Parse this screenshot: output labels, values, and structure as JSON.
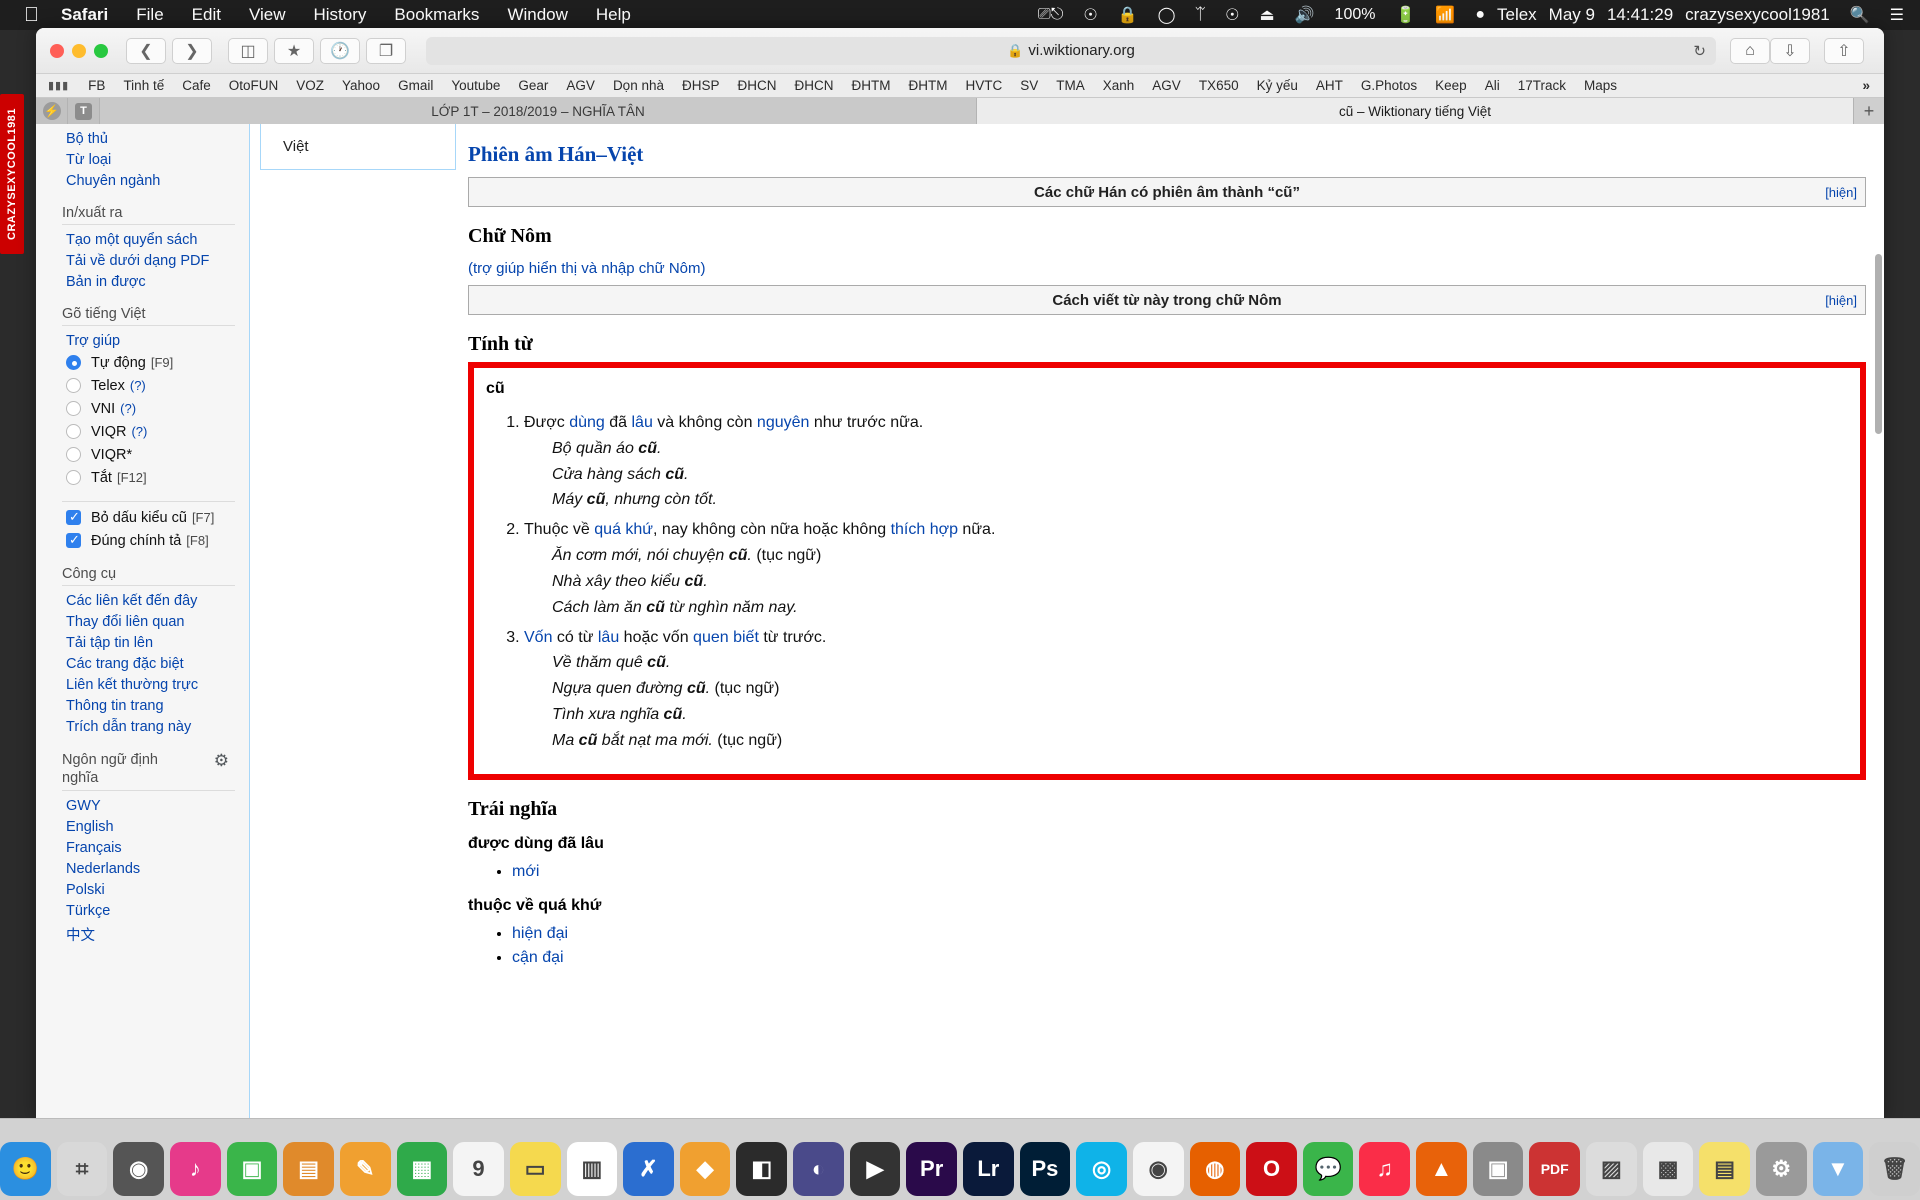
{
  "menubar": {
    "apple": "",
    "items": [
      "Safari",
      "File",
      "Edit",
      "View",
      "History",
      "Bookmarks",
      "Window",
      "Help"
    ],
    "status": {
      "screenshot_icon": "screenshot-icon",
      "creative_cloud_icon": "creative-cloud-icon",
      "lock_icon": "lock-icon",
      "chat_icon": "chat-bubble-icon",
      "bluetooth_icon": "bluetooth-icon",
      "accessibility_icon": "accessibility-icon",
      "eject_icon": "eject-icon",
      "volume_icon": "volume-icon",
      "battery_percent": "100%",
      "battery_icon": "battery-charging-icon",
      "wifi_icon": "wifi-icon",
      "input_method_icon": "keyboard-input-icon",
      "input_method": "Telex",
      "date": "May 9",
      "time": "14:41:29",
      "user": "crazysexycool1981",
      "search_icon": "search-icon",
      "control_center_icon": "control-center-icon"
    }
  },
  "toolbar": {
    "back_icon": "chevron-left-icon",
    "forward_icon": "chevron-right-icon",
    "sidebar_icon": "sidebar-icon",
    "bookmarks_icon": "star-bookmarks-icon",
    "history_icon": "clock-history-icon",
    "tabs_icon": "tab-overview-icon",
    "url": "vi.wiktionary.org",
    "lock_icon": "lock-icon",
    "reload_icon": "reload-icon",
    "home_icon": "home-icon",
    "download_icon": "download-icon",
    "share_icon": "share-icon"
  },
  "bookmarks": {
    "grid_icon": "apps-grid-icon",
    "items": [
      "FB",
      "Tinh tế",
      "Cafe",
      "OtoFUN",
      "VOZ",
      "Yahoo",
      "Gmail",
      "Youtube",
      "Gear",
      "AGV",
      "Dọn nhà",
      "ĐHSP",
      "ĐHCN",
      "ĐHCN",
      "ĐHTM",
      "ĐHTM",
      "HVTC",
      "SV",
      "TMA",
      "Xanh",
      "AGV",
      "TX650",
      "Kỷ yếu",
      "AHT",
      "G.Photos",
      "Keep",
      "Ali",
      "17Track",
      "Maps"
    ],
    "overflow": "»"
  },
  "tabs": {
    "messenger_icon": "messenger-icon",
    "telex_icon": "telex-icon",
    "items": [
      {
        "label": "LỚP 1T – 2018/2019 – NGHĨA TÂN",
        "active": false
      },
      {
        "label": "cũ – Wiktionary tiếng Việt",
        "active": true
      }
    ],
    "new_tab": "+"
  },
  "left_strip": {
    "label": "CRAZYSEXYCOOL1981"
  },
  "sidebar": {
    "top_links": [
      "Bộ thủ",
      "Từ loại",
      "Chuyên ngành"
    ],
    "sections": [
      {
        "title": "In/xuất ra",
        "links": [
          "Tạo một quyển sách",
          "Tải về dưới dạng PDF",
          "Bản in được"
        ]
      },
      {
        "title": "Gõ tiếng Việt",
        "links": [
          "Trợ giúp"
        ]
      }
    ],
    "input_modes": [
      {
        "label": "Tự động",
        "key": "[F9]",
        "hint": "",
        "selected": true
      },
      {
        "label": "Telex",
        "key": "",
        "hint": "(?)",
        "selected": false
      },
      {
        "label": "VNI",
        "key": "",
        "hint": "(?)",
        "selected": false
      },
      {
        "label": "VIQR",
        "key": "",
        "hint": "(?)",
        "selected": false
      },
      {
        "label": "VIQR*",
        "key": "",
        "hint": "",
        "selected": false
      },
      {
        "label": "Tắt",
        "key": "[F12]",
        "hint": "",
        "selected": false
      }
    ],
    "checkboxes": [
      {
        "label": "Bỏ dấu kiểu cũ",
        "key": "[F7]",
        "checked": true
      },
      {
        "label": "Đúng chính tả",
        "key": "[F8]",
        "checked": true
      }
    ],
    "tools_title": "Công cụ",
    "tools": [
      "Các liên kết đến đây",
      "Thay đổi liên quan",
      "Tải tập tin lên",
      "Các trang đặc biệt",
      "Liên kết thường trực",
      "Thông tin trang",
      "Trích dẫn trang này"
    ],
    "langs_title": "Ngôn ngữ định nghĩa",
    "langs_gear_icon": "gear-icon",
    "langs": [
      "GWY",
      "English",
      "Français",
      "Nederlands",
      "Polski",
      "Türkçe",
      "中文"
    ]
  },
  "namespace_tab": "Việt",
  "article": {
    "h_phien_am": "Phiên âm Hán–Việt",
    "navbox_han": {
      "title": "Các chữ Hán có phiên âm thành “cũ”",
      "toggle": "[hiện]"
    },
    "h_chu_nom": "Chữ Nôm",
    "nom_help": "(trợ giúp hiển thị và nhập chữ Nôm)",
    "navbox_nom": {
      "title": "Cách viết từ này trong chữ Nôm",
      "toggle": "[hiện]"
    },
    "h_tinh_tu": "Tính từ",
    "lemma": "cũ",
    "definitions": [
      {
        "num": "1.",
        "parts": [
          {
            "t": "Được ",
            "link": false
          },
          {
            "t": "dùng",
            "link": true
          },
          {
            "t": " đã ",
            "link": false
          },
          {
            "t": "lâu",
            "link": true
          },
          {
            "t": " và không còn ",
            "link": false
          },
          {
            "t": "nguyên",
            "link": true
          },
          {
            "t": " như trước nữa.",
            "link": false
          }
        ],
        "examples": [
          {
            "italic": "Bộ quần áo ",
            "bold": "cũ",
            "tail": ".",
            "note": ""
          },
          {
            "italic": "Cửa hàng sách ",
            "bold": "cũ",
            "tail": ".",
            "note": ""
          },
          {
            "italic": "Máy ",
            "bold": "cũ",
            "tail": ", nhưng còn tốt.",
            "note": ""
          }
        ]
      },
      {
        "num": "2.",
        "parts": [
          {
            "t": "Thuộc về ",
            "link": false
          },
          {
            "t": "quá khứ",
            "link": true
          },
          {
            "t": ", nay không còn nữa hoặc không ",
            "link": false
          },
          {
            "t": "thích hợp",
            "link": true
          },
          {
            "t": " nữa.",
            "link": false
          }
        ],
        "examples": [
          {
            "italic": "Ăn cơm mới, nói chuyện ",
            "bold": "cũ",
            "tail": ".",
            "note": " (tục ngữ)"
          },
          {
            "italic": "Nhà xây theo kiểu ",
            "bold": "cũ",
            "tail": ".",
            "note": ""
          },
          {
            "italic": "Cách làm ăn ",
            "bold": "cũ",
            "tail": " từ nghìn năm nay.",
            "note": ""
          }
        ]
      },
      {
        "num": "3.",
        "parts": [
          {
            "t": "Vốn",
            "link": true
          },
          {
            "t": " có từ ",
            "link": false
          },
          {
            "t": "lâu",
            "link": true
          },
          {
            "t": " hoặc vốn ",
            "link": false
          },
          {
            "t": "quen biết",
            "link": true
          },
          {
            "t": " từ trước.",
            "link": false
          }
        ],
        "examples": [
          {
            "italic": "Về thăm quê ",
            "bold": "cũ",
            "tail": ".",
            "note": ""
          },
          {
            "italic": "Ngựa quen đường ",
            "bold": "cũ",
            "tail": ".",
            "note": " (tục ngữ)"
          },
          {
            "italic": "Tình xưa nghĩa ",
            "bold": "cũ",
            "tail": ".",
            "note": ""
          },
          {
            "italic": "Ma ",
            "bold": "cũ",
            "tail": " bắt nạt ma mới.",
            "note": " (tục ngữ)"
          }
        ]
      }
    ],
    "h_trai_nghia": "Trái nghĩa",
    "antonym_groups": [
      {
        "title": "được dùng đã lâu",
        "items": [
          "mới"
        ]
      },
      {
        "title": "thuộc về quá khứ",
        "items": [
          "hiện đại",
          "cận đại"
        ]
      }
    ]
  },
  "dock": {
    "items": [
      {
        "name": "finder",
        "glyph": "🙂",
        "color": "#2b8fe0"
      },
      {
        "name": "launchpad",
        "glyph": "⌗",
        "color": "#d8d8d8"
      },
      {
        "name": "photo-booth",
        "glyph": "◉",
        "color": "#555"
      },
      {
        "name": "itunes",
        "glyph": "♪",
        "color": "#e63a8a"
      },
      {
        "name": "facetime",
        "glyph": "▣",
        "color": "#3ab54a"
      },
      {
        "name": "books",
        "glyph": "▤",
        "color": "#e08a2b"
      },
      {
        "name": "pages",
        "glyph": "✎",
        "color": "#f0a030"
      },
      {
        "name": "numbers",
        "glyph": "▦",
        "color": "#2faa4a"
      },
      {
        "name": "keynote",
        "glyph": "9",
        "color": "#f4f4f4"
      },
      {
        "name": "notes",
        "glyph": "▭",
        "color": "#f5d94e"
      },
      {
        "name": "calendar",
        "glyph": "▥",
        "color": "#ffffff"
      },
      {
        "name": "xcode",
        "glyph": "✗",
        "color": "#2b6ed0"
      },
      {
        "name": "sketch",
        "glyph": "◆",
        "color": "#f0a030"
      },
      {
        "name": "final-cut",
        "glyph": "◧",
        "color": "#2b2b2b"
      },
      {
        "name": "compressor",
        "glyph": "◐",
        "color": "#4a4a8a"
      },
      {
        "name": "logic",
        "glyph": "▶",
        "color": "#333"
      },
      {
        "name": "premiere",
        "glyph": "Pr",
        "color": "#2a0a4a"
      },
      {
        "name": "lightroom",
        "glyph": "Lr",
        "color": "#0a1a3a"
      },
      {
        "name": "photoshop",
        "glyph": "Ps",
        "color": "#001e36"
      },
      {
        "name": "safari",
        "glyph": "◎",
        "color": "#0fb3e8"
      },
      {
        "name": "chrome",
        "glyph": "◉",
        "color": "#f4f4f4"
      },
      {
        "name": "firefox",
        "glyph": "◍",
        "color": "#e66000"
      },
      {
        "name": "opera",
        "glyph": "O",
        "color": "#cc0f16"
      },
      {
        "name": "messages",
        "glyph": "💬",
        "color": "#3ab54a"
      },
      {
        "name": "music",
        "glyph": "♫",
        "color": "#fa2d48"
      },
      {
        "name": "vlc",
        "glyph": "▲",
        "color": "#e8620a"
      },
      {
        "name": "unarchiver",
        "glyph": "▣",
        "color": "#8a8a8a"
      },
      {
        "name": "pdf-expert",
        "glyph": "PDF",
        "color": "#cc3333"
      },
      {
        "name": "preview",
        "glyph": "▨",
        "color": "#dcdcdc"
      },
      {
        "name": "shutter-counter",
        "glyph": "▩",
        "color": "#e8e8e8"
      },
      {
        "name": "stickies",
        "glyph": "▤",
        "color": "#f5e06a"
      },
      {
        "name": "system-preferences",
        "glyph": "⚙",
        "color": "#9a9a9a"
      },
      {
        "name": "downloads-folder",
        "glyph": "▼",
        "color": "#7ab4e8"
      },
      {
        "name": "trash",
        "glyph": "🗑",
        "color": "#cfcfcf"
      }
    ]
  }
}
